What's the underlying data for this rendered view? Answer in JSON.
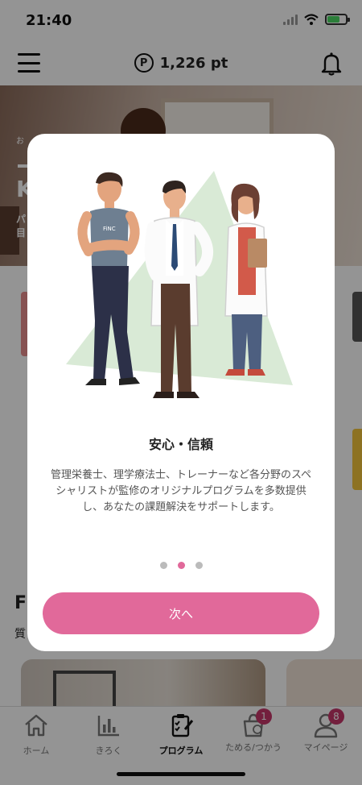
{
  "status": {
    "time": "21:40"
  },
  "header": {
    "points_icon": "P",
    "points_text": "1,226 pt"
  },
  "hero": {
    "tag": "お",
    "line1": "K",
    "sub1": "パ",
    "sub2": "目"
  },
  "feed": {
    "section_title": "F",
    "section_sub": "質"
  },
  "tabs": [
    {
      "label": "ホーム",
      "icon": "home-icon"
    },
    {
      "label": "きろく",
      "icon": "chart-icon"
    },
    {
      "label": "プログラム",
      "icon": "program-icon",
      "active": true
    },
    {
      "label": "ためる/つかう",
      "icon": "bag-icon",
      "badge": "1"
    },
    {
      "label": "マイページ",
      "icon": "person-icon",
      "badge": "8"
    }
  ],
  "modal": {
    "title": "安心・信頼",
    "body": "管理栄養士、理学療法士、トレーナーなど各分野のスペシャリストが監修のオリジナルプログラムを多数提供し、あなたの課題解決をサポートします。",
    "shirt_logo": "FiNC",
    "page_index": 2,
    "page_count": 3,
    "next_label": "次へ"
  },
  "colors": {
    "accent": "#e1699a",
    "badge": "#c7366a",
    "illustration_bg": "#d9ead6"
  }
}
